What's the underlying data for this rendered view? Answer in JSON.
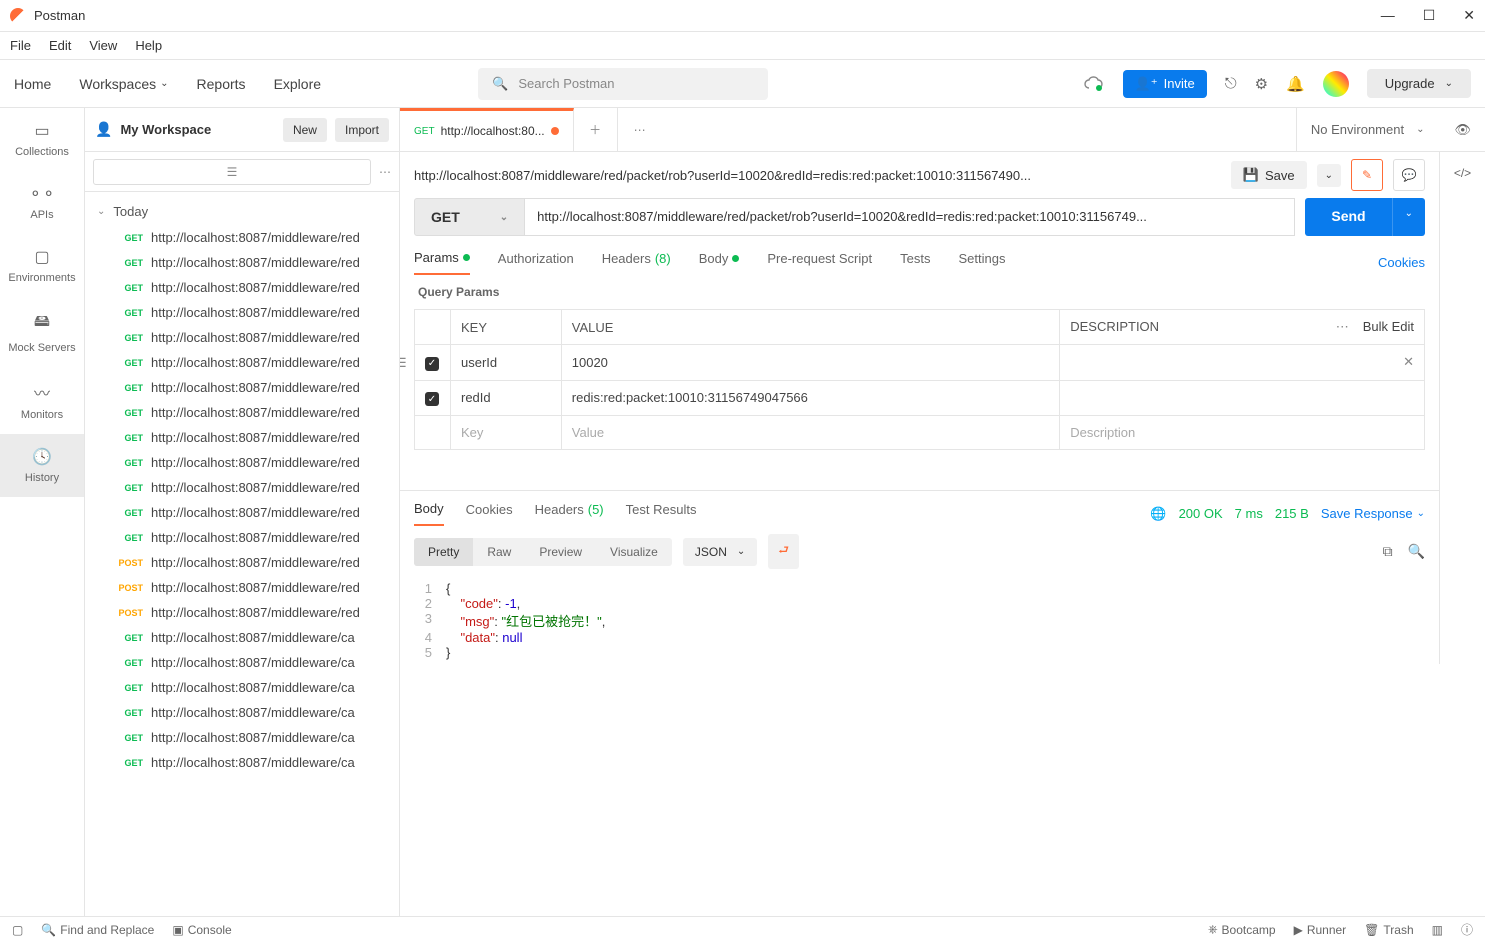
{
  "app": {
    "title": "Postman"
  },
  "menubar": [
    "File",
    "Edit",
    "View",
    "Help"
  ],
  "topnav": {
    "home": "Home",
    "workspaces": "Workspaces",
    "reports": "Reports",
    "explore": "Explore"
  },
  "search": {
    "placeholder": "Search Postman"
  },
  "invite": "Invite",
  "upgrade": "Upgrade",
  "workspace": {
    "name": "My Workspace",
    "new_btn": "New",
    "import_btn": "Import"
  },
  "sidebar": {
    "collections": "Collections",
    "apis": "APIs",
    "environments": "Environments",
    "mockservers": "Mock Servers",
    "monitors": "Monitors",
    "history": "History"
  },
  "history_group": "Today",
  "history_items": [
    {
      "m": "GET",
      "u": "http://localhost:8087/middleware/red"
    },
    {
      "m": "GET",
      "u": "http://localhost:8087/middleware/red"
    },
    {
      "m": "GET",
      "u": "http://localhost:8087/middleware/red"
    },
    {
      "m": "GET",
      "u": "http://localhost:8087/middleware/red"
    },
    {
      "m": "GET",
      "u": "http://localhost:8087/middleware/red"
    },
    {
      "m": "GET",
      "u": "http://localhost:8087/middleware/red"
    },
    {
      "m": "GET",
      "u": "http://localhost:8087/middleware/red"
    },
    {
      "m": "GET",
      "u": "http://localhost:8087/middleware/red"
    },
    {
      "m": "GET",
      "u": "http://localhost:8087/middleware/red"
    },
    {
      "m": "GET",
      "u": "http://localhost:8087/middleware/red"
    },
    {
      "m": "GET",
      "u": "http://localhost:8087/middleware/red"
    },
    {
      "m": "GET",
      "u": "http://localhost:8087/middleware/red"
    },
    {
      "m": "GET",
      "u": "http://localhost:8087/middleware/red"
    },
    {
      "m": "POST",
      "u": "http://localhost:8087/middleware/red"
    },
    {
      "m": "POST",
      "u": "http://localhost:8087/middleware/red"
    },
    {
      "m": "POST",
      "u": "http://localhost:8087/middleware/red"
    },
    {
      "m": "GET",
      "u": "http://localhost:8087/middleware/ca"
    },
    {
      "m": "GET",
      "u": "http://localhost:8087/middleware/ca"
    },
    {
      "m": "GET",
      "u": "http://localhost:8087/middleware/ca"
    },
    {
      "m": "GET",
      "u": "http://localhost:8087/middleware/ca"
    },
    {
      "m": "GET",
      "u": "http://localhost:8087/middleware/ca"
    },
    {
      "m": "GET",
      "u": "http://localhost:8087/middleware/ca"
    }
  ],
  "tab": {
    "method": "GET",
    "title": "http://localhost:80..."
  },
  "environment": "No Environment",
  "request": {
    "display_url": "http://localhost:8087/middleware/red/packet/rob?userId=10020&redId=redis:red:packet:10010:311567490...",
    "method": "GET",
    "url": "http://localhost:8087/middleware/red/packet/rob?userId=10020&redId=redis:red:packet:10010:31156749...",
    "save": "Save",
    "send": "Send"
  },
  "reqtabs": {
    "params": "Params",
    "auth": "Authorization",
    "headers": "Headers",
    "headers_count": "(8)",
    "body": "Body",
    "prereq": "Pre-request Script",
    "tests": "Tests",
    "settings": "Settings",
    "cookies": "Cookies"
  },
  "query_params_label": "Query Params",
  "params_headers": {
    "key": "KEY",
    "value": "VALUE",
    "desc": "DESCRIPTION",
    "bulkedit": "Bulk Edit"
  },
  "params_rows": [
    {
      "enabled": true,
      "key": "userId",
      "value": "10020",
      "desc": ""
    },
    {
      "enabled": true,
      "key": "redId",
      "value": "redis:red:packet:10010:31156749047566",
      "desc": ""
    }
  ],
  "params_placeholder": {
    "key": "Key",
    "value": "Value",
    "desc": "Description"
  },
  "resp_tabs": {
    "body": "Body",
    "cookies": "Cookies",
    "headers": "Headers",
    "headers_count": "(5)",
    "tests": "Test Results"
  },
  "resp_meta": {
    "status": "200 OK",
    "time": "7 ms",
    "size": "215 B",
    "save": "Save Response"
  },
  "viewer": {
    "pretty": "Pretty",
    "raw": "Raw",
    "preview": "Preview",
    "visualize": "Visualize",
    "format": "JSON"
  },
  "response_json": {
    "code": -1,
    "msg": "红包已被抢完！",
    "data": null
  },
  "statusbar": {
    "find": "Find and Replace",
    "console": "Console",
    "bootcamp": "Bootcamp",
    "runner": "Runner",
    "trash": "Trash"
  }
}
